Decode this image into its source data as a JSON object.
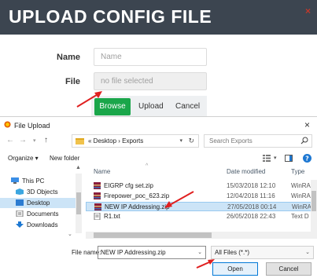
{
  "config_panel": {
    "title": "UPLOAD CONFIG FILE",
    "close_glyph": "×",
    "name_label": "Name",
    "name_placeholder": "Name",
    "file_label": "File",
    "file_value": "no file selected",
    "browse_label": "Browse",
    "upload_label": "Upload",
    "cancel_label": "Cancel"
  },
  "dialog": {
    "title": "File Upload",
    "close_glyph": "×",
    "breadcrumb": "« Desktop › Exports",
    "search_placeholder": "Search Exports",
    "organize_label": "Organize ▾",
    "new_folder_label": "New folder",
    "nav_items": [
      {
        "label": "This PC",
        "icon": "pc-icon"
      },
      {
        "label": "3D Objects",
        "icon": "3d-objects-icon"
      },
      {
        "label": "Desktop",
        "icon": "desktop-icon"
      },
      {
        "label": "Documents",
        "icon": "documents-icon"
      },
      {
        "label": "Downloads",
        "icon": "downloads-icon"
      }
    ],
    "columns": {
      "name": "Name",
      "date": "Date modified",
      "type": "Type"
    },
    "files": [
      {
        "name": "EIGRP cfg set.zip",
        "date": "15/03/2018 12:10",
        "type": "WinRA"
      },
      {
        "name": "Firepower_poc_623.zip",
        "date": "12/04/2018 11:16",
        "type": "WinRA"
      },
      {
        "name": "NEW IP Addressing.zip",
        "date": "27/05/2018 00:14",
        "type": "WinRA"
      },
      {
        "name": "R1.txt",
        "date": "26/05/2018 22:43",
        "type": "Text D"
      }
    ],
    "file_name_label": "File name:",
    "file_name_value": "NEW IP Addressing.zip",
    "file_type_value": "All Files (*.*)",
    "open_label": "Open",
    "cancel_label": "Cancel"
  },
  "colors": {
    "header_bg": "#3c4550",
    "browse_green": "#1aa64a",
    "selection_blue": "#cce4f7",
    "annotation_red": "#e02020"
  }
}
